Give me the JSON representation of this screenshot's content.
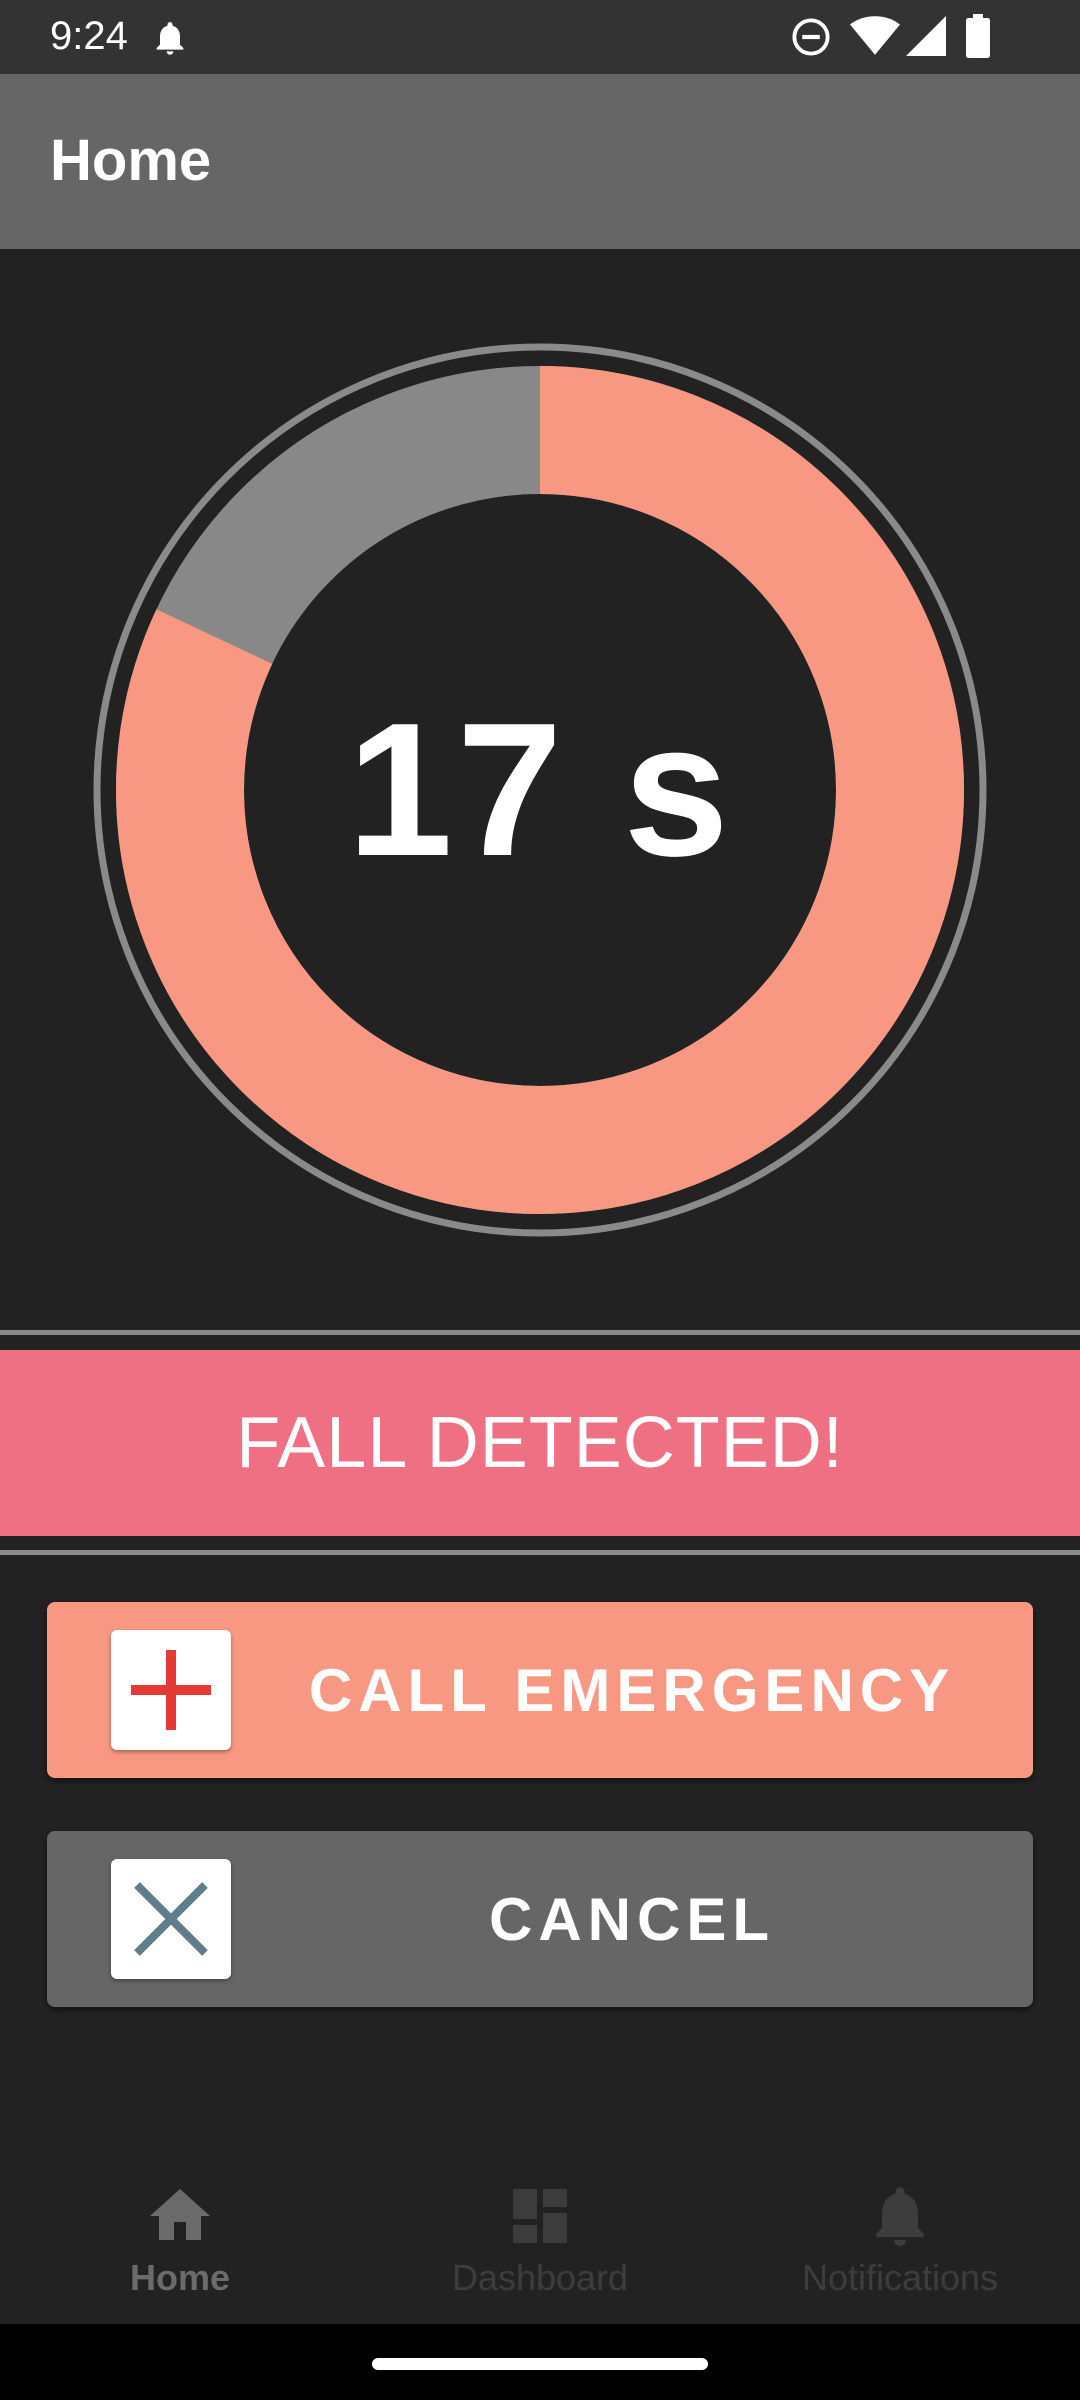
{
  "status_bar": {
    "time": "9:24",
    "icons": [
      "notification-bell-icon",
      "do-not-disturb-icon",
      "wifi-icon",
      "cellular-signal-icon",
      "battery-icon"
    ]
  },
  "app_bar": {
    "title": "Home"
  },
  "timer": {
    "text": "17 s",
    "remaining_fraction": 0.82,
    "colors": {
      "remaining": "#f89882",
      "elapsed": "#888888",
      "outline": "#8a8a8a",
      "center": "#222222"
    }
  },
  "alert": {
    "text": "FALL DETECTED!",
    "color": "#f07083"
  },
  "actions": {
    "emergency": {
      "label": "CALL EMERGENCY",
      "icon": "plus-icon",
      "color": "#f89882",
      "icon_color": "#e53935"
    },
    "cancel": {
      "label": "CANCEL",
      "icon": "close-icon",
      "color": "#666666",
      "icon_color": "#607d8b"
    }
  },
  "bottom_nav": {
    "items": [
      {
        "label": "Home",
        "icon": "home-icon",
        "active": true
      },
      {
        "label": "Dashboard",
        "icon": "dashboard-icon",
        "active": false
      },
      {
        "label": "Notifications",
        "icon": "bell-icon",
        "active": false
      }
    ]
  }
}
